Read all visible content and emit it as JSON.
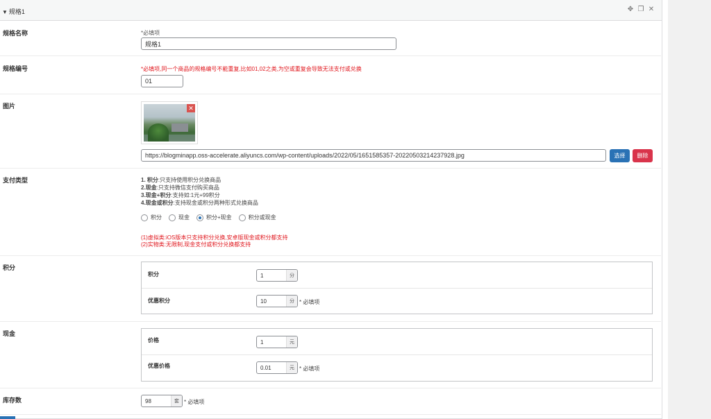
{
  "header": {
    "title": "规格1"
  },
  "spec_name": {
    "label": "规格名称",
    "required_note": "*必填项",
    "value": "规格1"
  },
  "spec_code": {
    "label": "规格编号",
    "required_note": "*必填项,同一个商品的规格编号不能重复,比如01,02之类,为空或重复会导致无法支付或兑换",
    "value": "01"
  },
  "image": {
    "label": "图片",
    "url": "https://blogminapp.oss-accelerate.aliyuncs.com/wp-content/uploads/2022/05/1651585357-20220503214237928.jpg",
    "select_label": "选择",
    "delete_label": "删除"
  },
  "pay_type": {
    "label": "支付类型",
    "desc": [
      {
        "key": "1. 积分",
        "text": ":只支持使用积分兑换商品"
      },
      {
        "key": "2.现金",
        "text": ":只支持微信支付购买商品"
      },
      {
        "key": "3.现金+积分",
        "text": ":支持如:1元+99积分"
      },
      {
        "key": "4.现金或积分",
        "text": ":支持现金或积分两种形式兑换商品"
      }
    ],
    "options": [
      "积分",
      "现金",
      "积分+现金",
      "积分或现金"
    ],
    "selected": 2,
    "notes": [
      "(1)虚拟类:iOS版本只支持积分兑换,安卓版现金或积分都支持",
      "(2)实物类:无限制,现金支付或积分兑换都支持"
    ]
  },
  "points": {
    "label": "积分",
    "rows": [
      {
        "label": "积分",
        "value": "1",
        "unit": "分",
        "req": ""
      },
      {
        "label": "优惠积分",
        "value": "10",
        "unit": "分",
        "req": "* 必填项"
      }
    ]
  },
  "cash": {
    "label": "现金",
    "rows": [
      {
        "label": "价格",
        "value": "1",
        "unit": "元",
        "req": ""
      },
      {
        "label": "优惠价格",
        "value": "0.01",
        "unit": "元",
        "req": "* 必填项"
      }
    ]
  },
  "stock": {
    "label": "库存数",
    "value": "98",
    "unit": "套",
    "req": "* 必填项"
  }
}
